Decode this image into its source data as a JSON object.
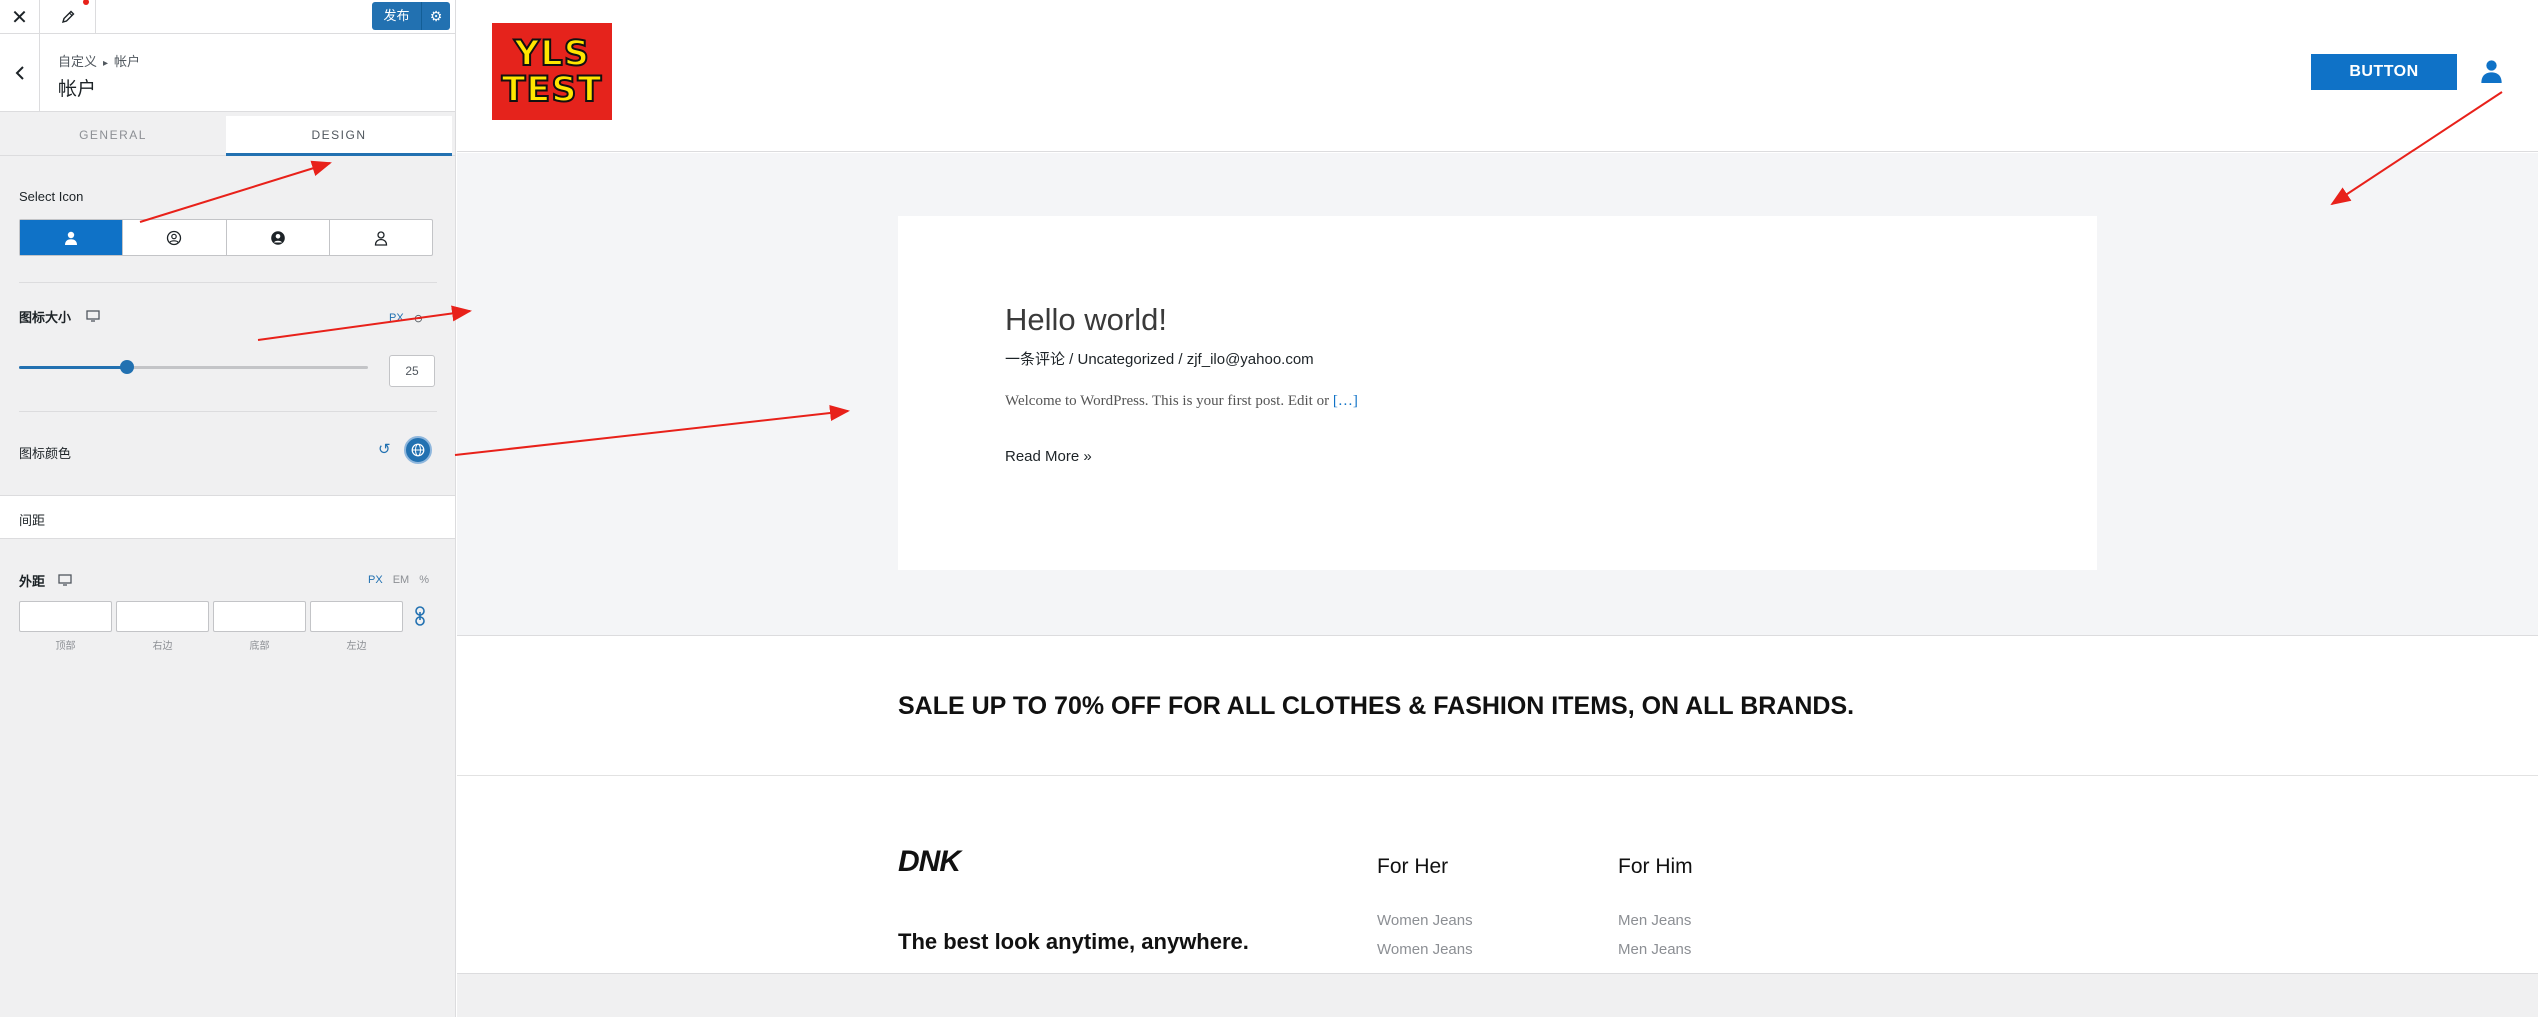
{
  "topbar": {
    "close_icon": "close-icon",
    "edit_icon": "pencil-icon",
    "publish_label": "发布",
    "settings_icon": "gear-icon"
  },
  "panel_header": {
    "breadcrumb_root": "自定义",
    "breadcrumb_current": "帐户",
    "title": "帐户"
  },
  "tabs": [
    {
      "label": "GENERAL",
      "active": false
    },
    {
      "label": "DESIGN",
      "active": true
    }
  ],
  "select_icon": {
    "label": "Select Icon",
    "options": [
      "user-solid-icon",
      "user-circle-outline-icon",
      "user-circle-solid-icon",
      "user-outline-icon"
    ],
    "selected_index": 0
  },
  "icon_size": {
    "label": "图标大小",
    "device_icon": "desktop-icon",
    "unit": "PX",
    "value": "25",
    "slider_fraction": 0.31
  },
  "icon_color": {
    "label": "图标颜色",
    "reset_icon": "reset-icon",
    "color": "#2271b1"
  },
  "section": {
    "label": "间距"
  },
  "margin": {
    "label": "外距",
    "device_icon": "desktop-icon",
    "units": [
      "PX",
      "EM",
      "%"
    ],
    "active_unit": "PX",
    "fields": [
      "顶部",
      "右边",
      "底部",
      "左边"
    ],
    "link_icon": "link-icon"
  },
  "site": {
    "logo_line1": "YLS",
    "logo_line2": "TEST",
    "header_button": "BUTTON",
    "account_icon": "user-account-icon",
    "accent": "#0f72c7"
  },
  "post": {
    "title": "Hello world!",
    "meta": "一条评论 / Uncategorized / zjf_ilo@yahoo.com",
    "excerpt": "Welcome to WordPress. This is your first post. Edit or",
    "excerpt_more": "[…]",
    "read_more": "Read More »"
  },
  "sale_banner": "SALE UP TO 70% OFF FOR ALL CLOTHES & FASHION ITEMS, ON ALL BRANDS.",
  "footer": {
    "brand": "DNK",
    "tagline": "The best look anytime, anywhere.",
    "columns": [
      {
        "title": "For Her",
        "links": [
          "Women Jeans",
          "Women Jeans"
        ]
      },
      {
        "title": "For Him",
        "links": [
          "Men Jeans",
          "Men Jeans"
        ]
      }
    ]
  }
}
